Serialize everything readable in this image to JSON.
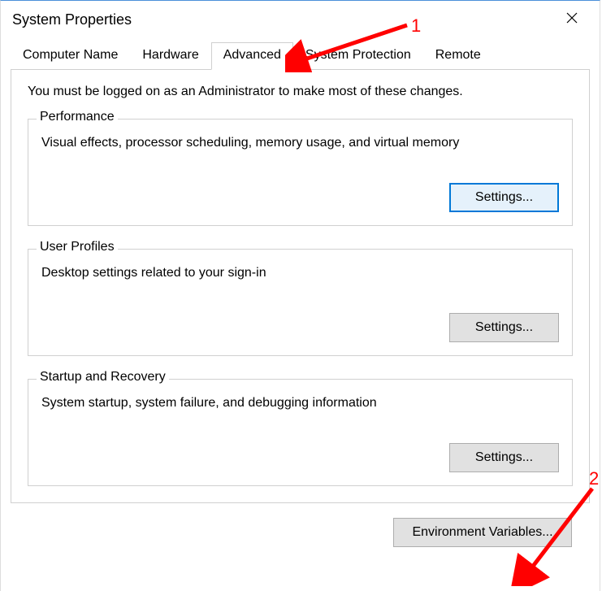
{
  "window": {
    "title": "System Properties"
  },
  "tabs": [
    {
      "label": "Computer Name",
      "active": false
    },
    {
      "label": "Hardware",
      "active": false
    },
    {
      "label": "Advanced",
      "active": true
    },
    {
      "label": "System Protection",
      "active": false
    },
    {
      "label": "Remote",
      "active": false
    }
  ],
  "intro": "You must be logged on as an Administrator to make most of these changes.",
  "groups": {
    "performance": {
      "legend": "Performance",
      "desc": "Visual effects, processor scheduling, memory usage, and virtual memory",
      "button": "Settings..."
    },
    "userprofiles": {
      "legend": "User Profiles",
      "desc": "Desktop settings related to your sign-in",
      "button": "Settings..."
    },
    "startup": {
      "legend": "Startup and Recovery",
      "desc": "System startup, system failure, and debugging information",
      "button": "Settings..."
    }
  },
  "footer": {
    "env_button": "Environment Variables..."
  },
  "annotations": {
    "label1": "1",
    "label2": "2"
  }
}
